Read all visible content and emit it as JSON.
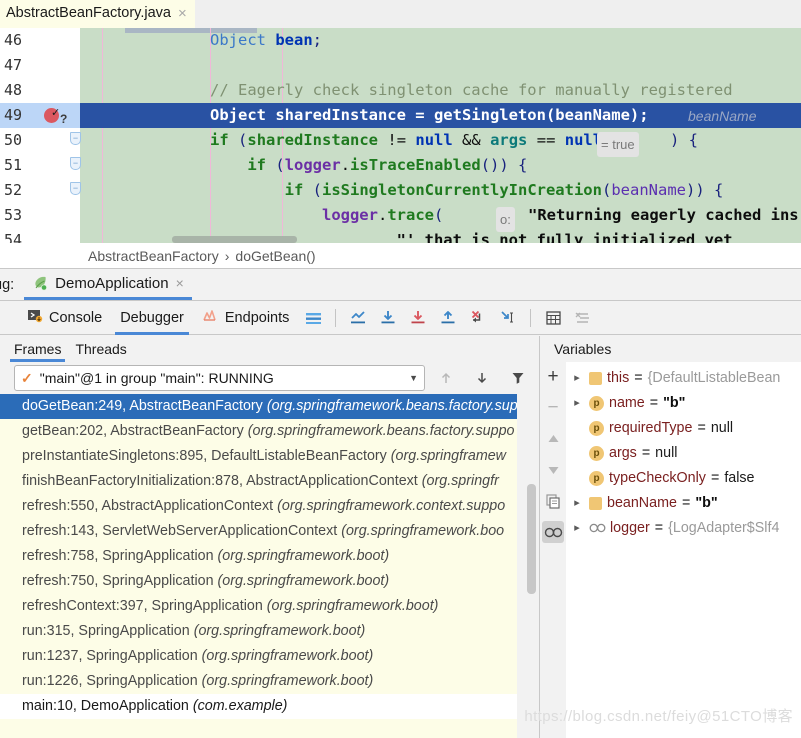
{
  "editor": {
    "tab": {
      "filename": "AbstractBeanFactory.java",
      "close": "×"
    },
    "line_numbers": [
      "46",
      "47",
      "48",
      "49",
      "50",
      "51",
      "52",
      "53",
      "54"
    ],
    "code_lines": [
      "Object bean;",
      "",
      "// Eagerly check singleton cache for manually registered",
      "Object sharedInstance = getSingleton(beanName);",
      "if (sharedInstance != null && args == null ) {",
      "if (logger.isTraceEnabled()) {",
      "if (isSingletonCurrentlyInCreation(beanName)) {",
      "logger.trace( \"Returning eagerly cached ins",
      "\"' that is not fully initialized yet"
    ],
    "inline_hints": {
      "args_value": "= true",
      "trace_param": "o:",
      "param_name": "beanName"
    },
    "breadcrumb": {
      "class": "AbstractBeanFactory",
      "separator": "›",
      "method": "doGetBean()"
    }
  },
  "debug_window": {
    "label": "ug:",
    "configuration": "DemoApplication",
    "config_close": "×",
    "tabs": [
      {
        "label": "Console",
        "icon": "console-icon",
        "active": false
      },
      {
        "label": "Debugger",
        "icon": "debugger-icon",
        "active": true
      },
      {
        "label": "Endpoints",
        "icon": "endpoints-icon",
        "active": false
      }
    ],
    "toolbar_icons": [
      "layout-icon",
      "show-execution-point-icon",
      "step-over-icon",
      "step-into-icon",
      "step-out-icon",
      "force-step-into-icon",
      "run-to-cursor-icon",
      "evaluate-expression-icon",
      "mute-breakpoints-icon"
    ]
  },
  "frames": {
    "tabs": [
      {
        "label": "Frames",
        "active": true
      },
      {
        "label": "Threads",
        "active": false
      }
    ],
    "thread_selector": {
      "value": "\"main\"@1 in group \"main\": RUNNING",
      "icon": "check-icon"
    },
    "nav_icons": [
      "arrow-up-icon",
      "arrow-down-icon",
      "filter-icon"
    ],
    "stack": [
      {
        "method": "doGetBean:249, AbstractBeanFactory",
        "package": "(org.springframework.beans.factory.sup",
        "selected": true
      },
      {
        "method": "getBean:202, AbstractBeanFactory",
        "package": "(org.springframework.beans.factory.suppo",
        "selected": false
      },
      {
        "method": "preInstantiateSingletons:895, DefaultListableBeanFactory",
        "package": "(org.springframew",
        "selected": false
      },
      {
        "method": "finishBeanFactoryInitialization:878, AbstractApplicationContext",
        "package": "(org.springfr",
        "selected": false
      },
      {
        "method": "refresh:550, AbstractApplicationContext",
        "package": "(org.springframework.context.suppo",
        "selected": false
      },
      {
        "method": "refresh:143, ServletWebServerApplicationContext",
        "package": "(org.springframework.boo",
        "selected": false
      },
      {
        "method": "refresh:758, SpringApplication",
        "package": "(org.springframework.boot)",
        "selected": false
      },
      {
        "method": "refresh:750, SpringApplication",
        "package": "(org.springframework.boot)",
        "selected": false
      },
      {
        "method": "refreshContext:397, SpringApplication",
        "package": "(org.springframework.boot)",
        "selected": false
      },
      {
        "method": "run:315, SpringApplication",
        "package": "(org.springframework.boot)",
        "selected": false
      },
      {
        "method": "run:1237, SpringApplication",
        "package": "(org.springframework.boot)",
        "selected": false
      },
      {
        "method": "run:1226, SpringApplication",
        "package": "(org.springframework.boot)",
        "selected": false
      },
      {
        "method": "main:10, DemoApplication",
        "package": "(com.example)",
        "selected": false,
        "last": true
      }
    ]
  },
  "variables": {
    "title": "Variables",
    "side_buttons": [
      "add-icon",
      "remove-icon",
      "move-up-icon",
      "move-down-icon",
      "copy-icon",
      "watches-icon"
    ],
    "items": [
      {
        "expandable": true,
        "icon": "object-icon",
        "name": "this",
        "eq": "=",
        "value": "{DefaultListableBean",
        "kind": "obj"
      },
      {
        "expandable": true,
        "icon": "param-icon",
        "name": "name",
        "eq": "=",
        "value": "\"b\"",
        "kind": "str"
      },
      {
        "expandable": false,
        "icon": "param-icon",
        "name": "requiredType",
        "eq": "=",
        "value": "null",
        "kind": "null"
      },
      {
        "expandable": false,
        "icon": "param-icon",
        "name": "args",
        "eq": "=",
        "value": "null",
        "kind": "null"
      },
      {
        "expandable": false,
        "icon": "param-icon",
        "name": "typeCheckOnly",
        "eq": "=",
        "value": "false",
        "kind": "null"
      },
      {
        "expandable": true,
        "icon": "object-icon",
        "name": "beanName",
        "eq": "=",
        "value": "\"b\"",
        "kind": "str"
      },
      {
        "expandable": true,
        "icon": "watch-icon",
        "name": "logger",
        "eq": "=",
        "value": "{LogAdapter$Slf4",
        "kind": "obj"
      }
    ]
  },
  "watermark": "https://blog.csdn.net/feiy@51CTO博客",
  "colors": {
    "accent": "#4a88d6",
    "selection": "#2b6cb8",
    "code_bg": "#c9ddc7",
    "current_line": "#2952a3",
    "tab_bg": "#fdfde7",
    "breakpoint": "#db5860"
  }
}
